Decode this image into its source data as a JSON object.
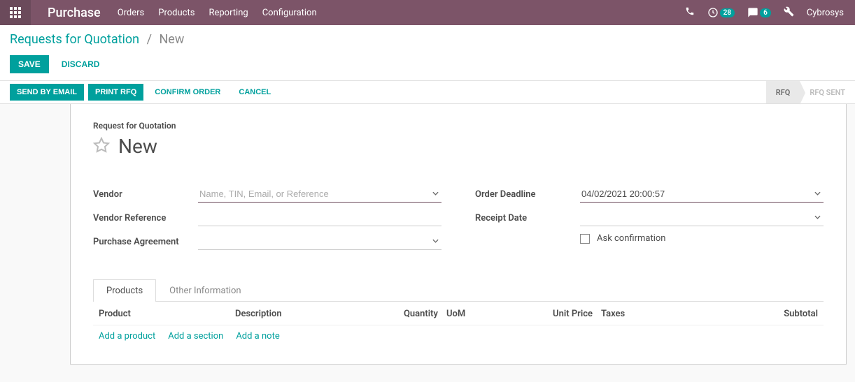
{
  "header": {
    "app_name": "Purchase",
    "nav": [
      "Orders",
      "Products",
      "Reporting",
      "Configuration"
    ],
    "activity_badge": "28",
    "discuss_badge": "6",
    "user": "Cybrosys"
  },
  "breadcrumb": {
    "parent": "Requests for Quotation",
    "current": "New"
  },
  "buttons": {
    "save": "SAVE",
    "discard": "DISCARD",
    "send_email": "SEND BY EMAIL",
    "print_rfq": "PRINT RFQ",
    "confirm": "CONFIRM ORDER",
    "cancel": "CANCEL"
  },
  "status": {
    "rfq": "RFQ",
    "rfq_sent": "RFQ SENT"
  },
  "form": {
    "section_title": "Request for Quotation",
    "record_title": "New",
    "labels": {
      "vendor": "Vendor",
      "vendor_ref": "Vendor Reference",
      "purchase_agreement": "Purchase Agreement",
      "order_deadline": "Order Deadline",
      "receipt_date": "Receipt Date",
      "ask_confirmation": "Ask confirmation"
    },
    "placeholders": {
      "vendor": "Name, TIN, Email, or Reference"
    },
    "values": {
      "order_deadline": "04/02/2021 20:00:57"
    }
  },
  "tabs": {
    "products": "Products",
    "other_info": "Other Information"
  },
  "table": {
    "columns": {
      "product": "Product",
      "description": "Description",
      "quantity": "Quantity",
      "uom": "UoM",
      "unit_price": "Unit Price",
      "taxes": "Taxes",
      "subtotal": "Subtotal"
    },
    "actions": {
      "add_product": "Add a product",
      "add_section": "Add a section",
      "add_note": "Add a note"
    }
  }
}
